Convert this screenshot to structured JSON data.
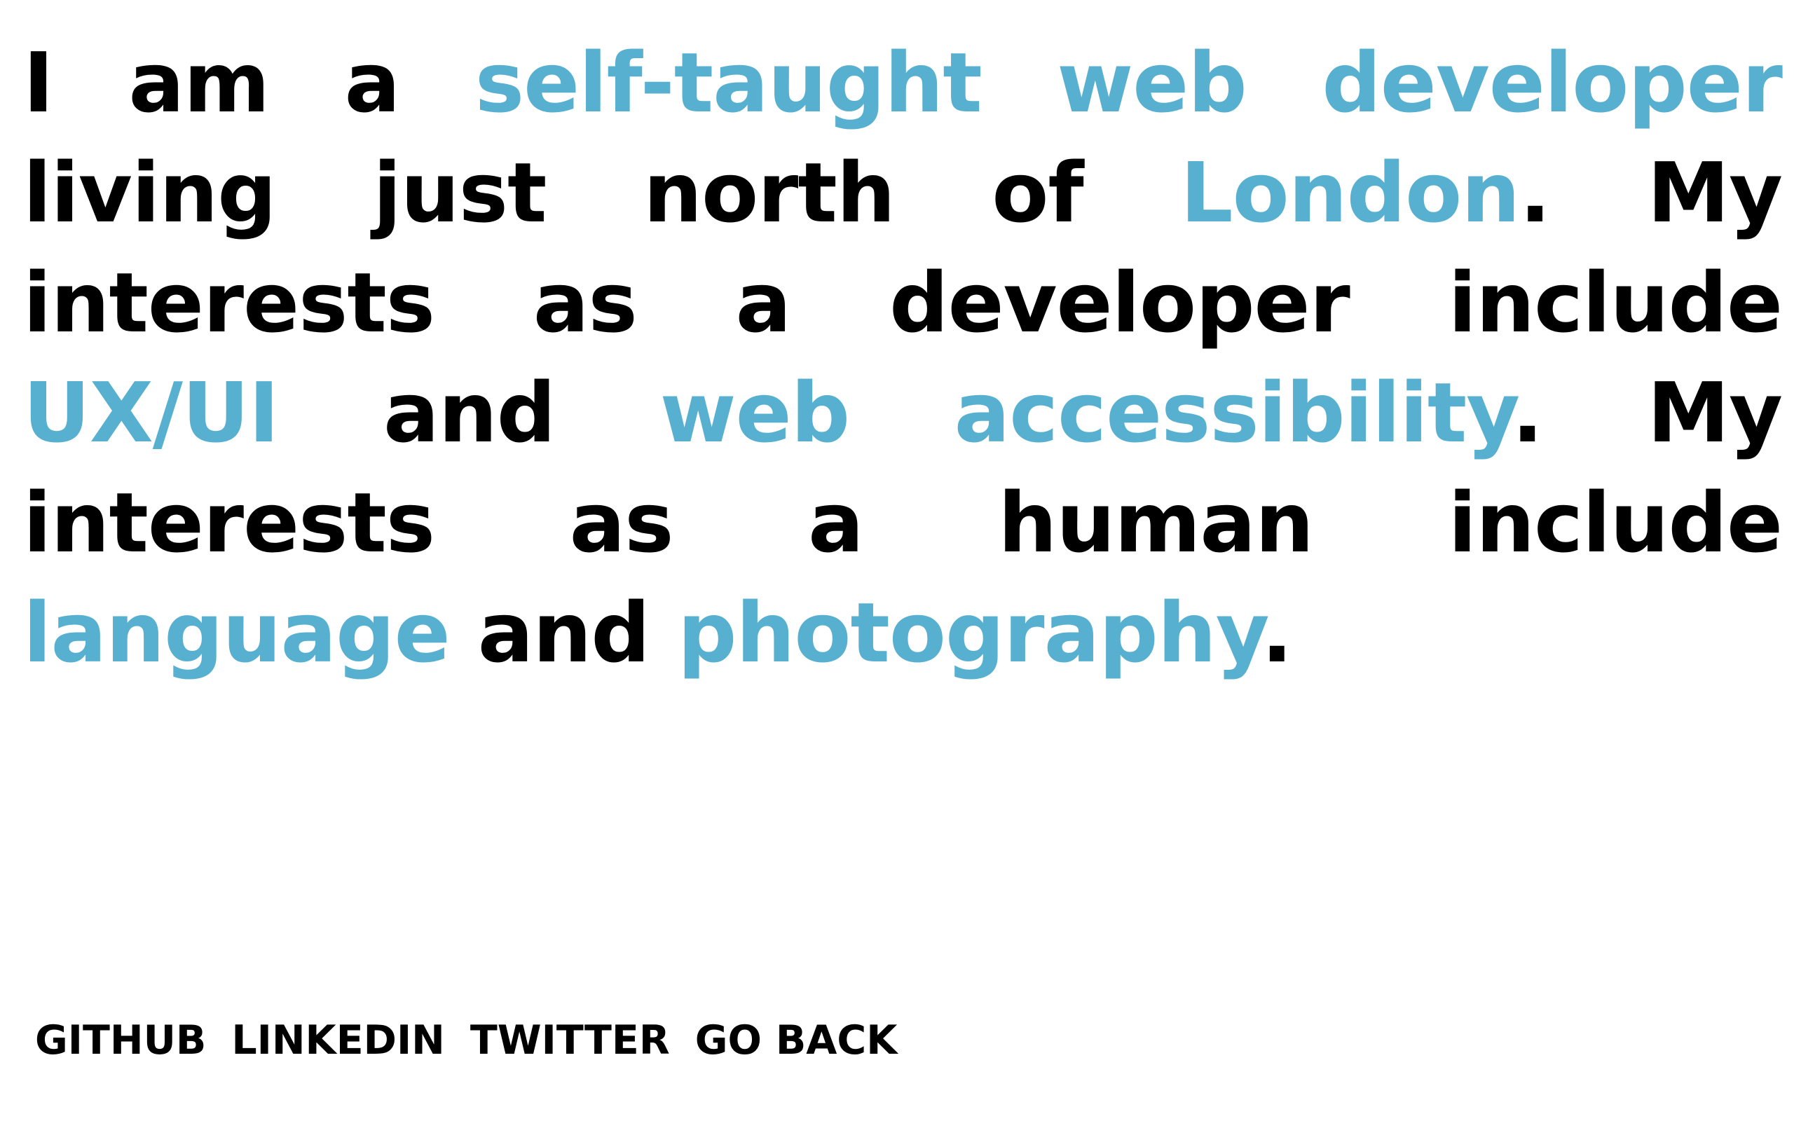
{
  "bio": {
    "segments": [
      {
        "text": "I am a ",
        "highlight": false
      },
      {
        "text": "self-taught web developer",
        "highlight": true
      },
      {
        "text": " living just north of ",
        "highlight": false
      },
      {
        "text": "London",
        "highlight": true
      },
      {
        "text": ". My interests as a developer include ",
        "highlight": false
      },
      {
        "text": "UX/UI",
        "highlight": true
      },
      {
        "text": " and ",
        "highlight": false
      },
      {
        "text": "web accessibility",
        "highlight": true
      },
      {
        "text": ". My interests as a human include ",
        "highlight": false
      },
      {
        "text": "language",
        "highlight": true
      },
      {
        "text": " and ",
        "highlight": false
      },
      {
        "text": "photography",
        "highlight": true
      },
      {
        "text": ".",
        "highlight": false
      }
    ]
  },
  "links": {
    "github": "GITHUB",
    "linkedin": "LINKEDIN",
    "twitter": "TWITTER",
    "go_back": "GO BACK"
  },
  "colors": {
    "text": "#000000",
    "accent": "#58b0d0",
    "background": "#ffffff"
  }
}
